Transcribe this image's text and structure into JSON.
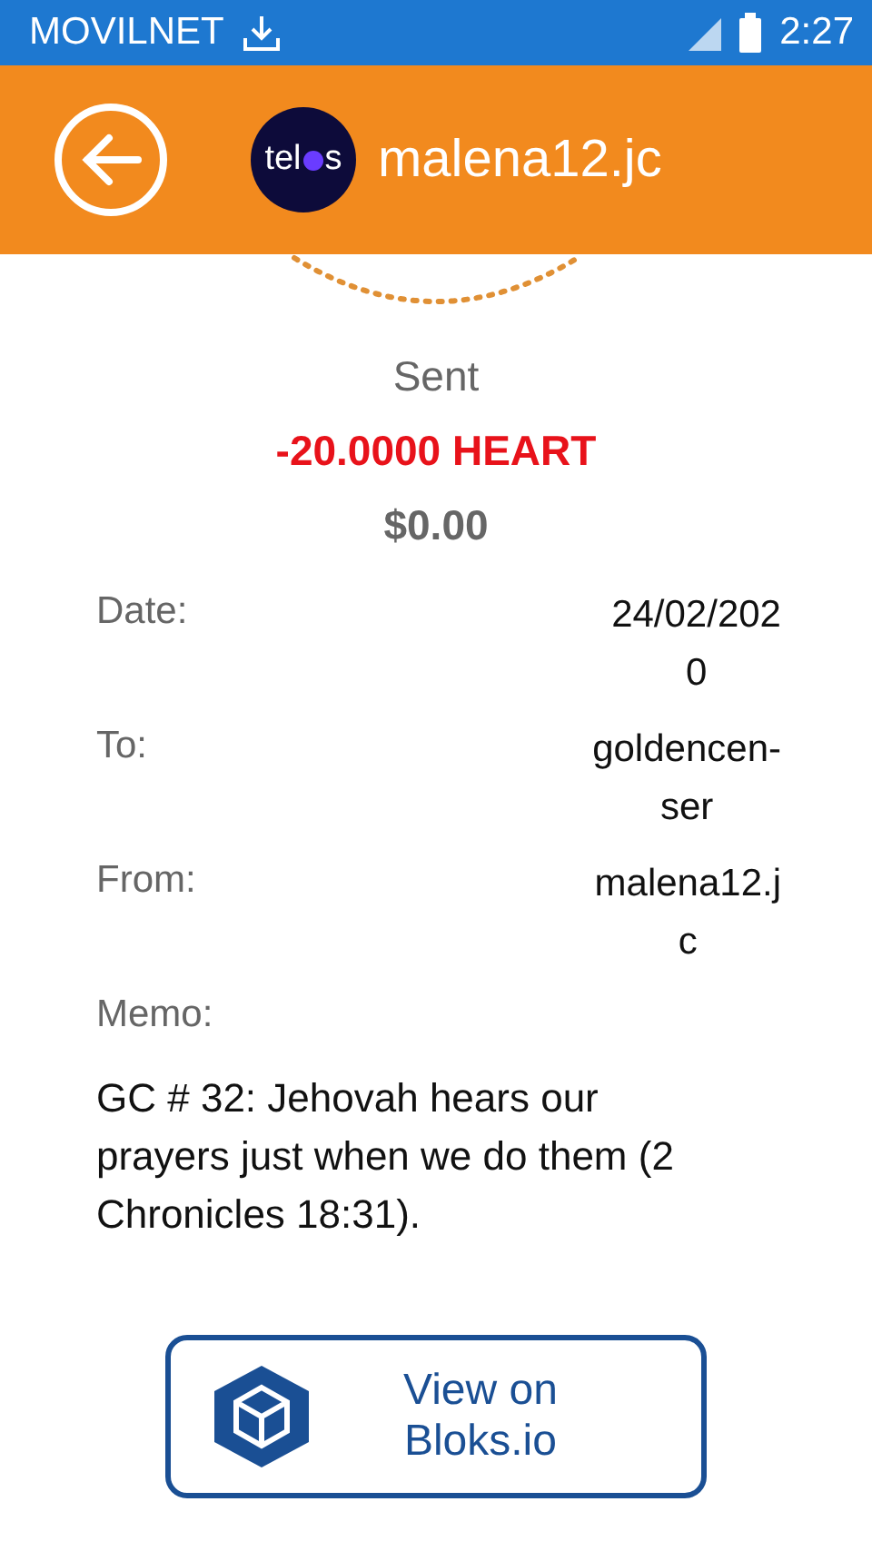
{
  "status_bar": {
    "carrier": "MOVILNET",
    "time": "2:27"
  },
  "header": {
    "logo": {
      "before": "tel",
      "after": "s"
    },
    "title": "malena12.jc"
  },
  "summary": {
    "status": "Sent",
    "amount": "-20.0000 HEART",
    "fiat": "$0.00"
  },
  "details": [
    {
      "label": "Date:",
      "value_lines": [
        "24/02/202",
        "0"
      ]
    },
    {
      "label": "To:",
      "value_lines": [
        "goldencen-",
        "ser"
      ]
    },
    {
      "label": "From:",
      "value_lines": [
        "malena12.j",
        "c"
      ]
    }
  ],
  "memo": {
    "label": "Memo:",
    "text": "GC # 32: Jehovah hears our prayers just when we do them (2 Chronicles 18:31)."
  },
  "button": {
    "label_lines": [
      "View on",
      "Bloks.io"
    ]
  }
}
